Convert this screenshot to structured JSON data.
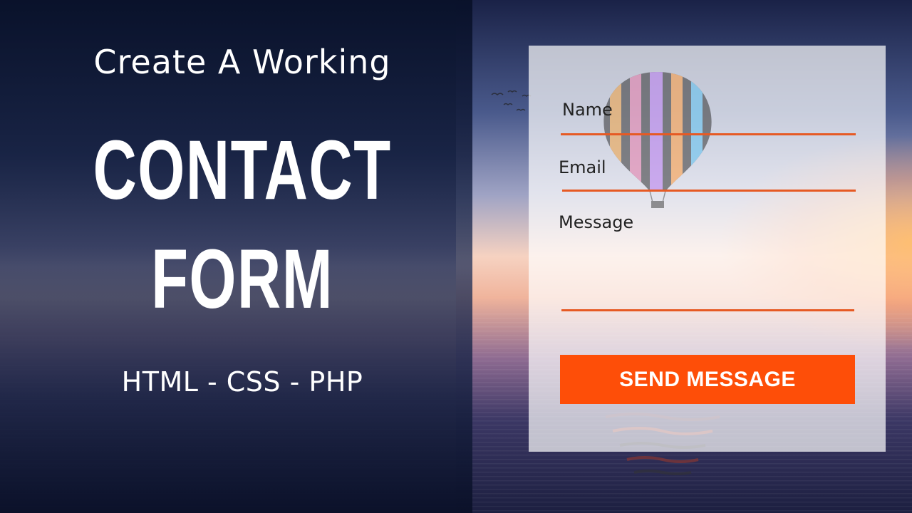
{
  "headline": {
    "subtitle": "Create A Working",
    "line1": "CONTACT",
    "line2": "FORM",
    "tech": "HTML - CSS - PHP"
  },
  "form": {
    "name_label": "Name",
    "email_label": "Email",
    "message_label": "Message",
    "submit_label": "SEND MESSAGE"
  },
  "colors": {
    "accent": "#fe4e08",
    "underline": "#e65a24",
    "card_bg": "rgba(255,255,255,0.7)",
    "text_dark": "#222222",
    "text_light": "#ffffff"
  }
}
